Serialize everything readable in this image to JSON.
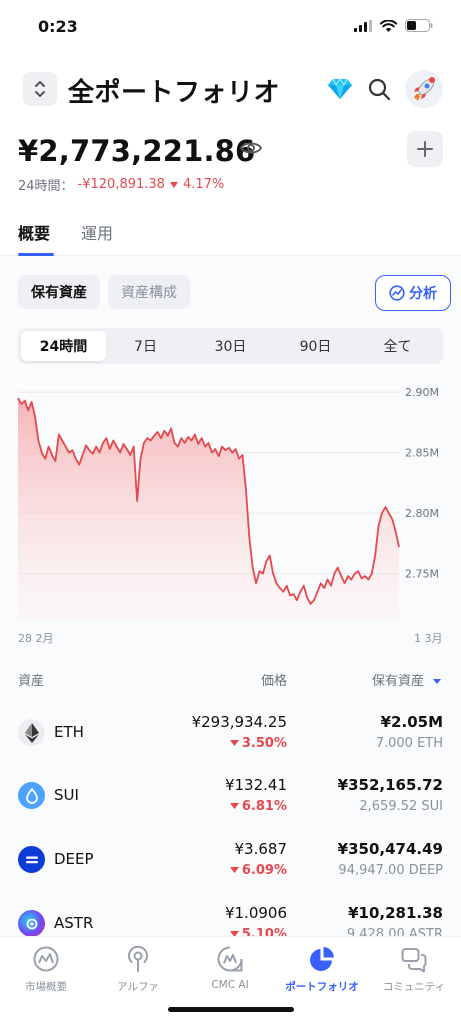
{
  "status_bar": {
    "time": "0:23"
  },
  "header": {
    "title": "全ポートフォリオ"
  },
  "portfolio": {
    "balance": "¥2,773,221.86",
    "change_label": "24時間：",
    "change_amount": "-¥120,891.38",
    "change_percent": "4.17%"
  },
  "tabs": [
    {
      "label": "概要",
      "active": true
    },
    {
      "label": "運用",
      "active": false
    }
  ],
  "view_chips": [
    {
      "label": "保有資産",
      "active": true
    },
    {
      "label": "資産構成",
      "active": false
    }
  ],
  "analyze_label": "分析",
  "ranges": [
    {
      "label": "24時間",
      "active": true
    },
    {
      "label": "7日",
      "active": false
    },
    {
      "label": "30日",
      "active": false
    },
    {
      "label": "90日",
      "active": false
    },
    {
      "label": "全て",
      "active": false
    }
  ],
  "chart_data": {
    "type": "area",
    "title": "",
    "xlabel": "",
    "ylabel": "",
    "x_start_label": "28 2月",
    "x_end_label": "1 3月",
    "y_ticks": [
      2900000,
      2850000,
      2800000,
      2750000
    ],
    "y_tick_labels": [
      "2.90M",
      "2.85M",
      "2.80M",
      "2.75M"
    ],
    "ylim": [
      2710000,
      2910000
    ],
    "grid": true,
    "color": "#e5484d",
    "series": [
      {
        "values": [
          2895000,
          2890000,
          2893000,
          2885000,
          2892000,
          2880000,
          2860000,
          2850000,
          2845000,
          2855000,
          2848000,
          2843000,
          2865000,
          2860000,
          2855000,
          2850000,
          2852000,
          2845000,
          2840000,
          2848000,
          2856000,
          2852000,
          2849000,
          2855000,
          2850000,
          2858000,
          2862000,
          2853000,
          2860000,
          2855000,
          2850000,
          2857000,
          2853000,
          2848000,
          2855000,
          2810000,
          2845000,
          2858000,
          2862000,
          2860000,
          2864000,
          2867000,
          2862000,
          2868000,
          2864000,
          2870000,
          2858000,
          2855000,
          2862000,
          2858000,
          2863000,
          2860000,
          2865000,
          2857000,
          2862000,
          2855000,
          2858000,
          2850000,
          2853000,
          2847000,
          2855000,
          2852000,
          2854000,
          2850000,
          2853000,
          2845000,
          2848000,
          2820000,
          2780000,
          2755000,
          2742000,
          2752000,
          2750000,
          2760000,
          2765000,
          2750000,
          2742000,
          2738000,
          2735000,
          2740000,
          2732000,
          2733000,
          2728000,
          2735000,
          2740000,
          2730000,
          2725000,
          2728000,
          2735000,
          2742000,
          2738000,
          2745000,
          2740000,
          2750000,
          2755000,
          2748000,
          2742000,
          2748000,
          2745000,
          2750000,
          2752000,
          2746000,
          2748000,
          2745000,
          2750000,
          2765000,
          2790000,
          2800000,
          2805000,
          2800000,
          2795000,
          2785000,
          2772000
        ]
      }
    ]
  },
  "assets_header": {
    "col_asset": "資産",
    "col_price": "価格",
    "col_holdings": "保有資産"
  },
  "assets": [
    {
      "symbol": "ETH",
      "price": "¥293,934.25",
      "change": "3.50%",
      "value": "¥2.05M",
      "amount": "7.000 ETH",
      "icon": "ethereum-icon",
      "color": "#ecedf0"
    },
    {
      "symbol": "SUI",
      "price": "¥132.41",
      "change": "6.81%",
      "value": "¥352,165.72",
      "amount": "2,659.52 SUI",
      "icon": "sui-icon",
      "color": "#4da2ff"
    },
    {
      "symbol": "DEEP",
      "price": "¥3.687",
      "change": "6.09%",
      "value": "¥350,474.49",
      "amount": "94,947.00 DEEP",
      "icon": "deep-icon",
      "color": "#0d3bd6"
    },
    {
      "symbol": "ASTR",
      "price": "¥1.0906",
      "change": "5.10%",
      "value": "¥10,281.38",
      "amount": "9,428.00 ASTR",
      "icon": "astar-icon",
      "color": "#6d4cf5"
    }
  ],
  "bottom_nav": [
    {
      "label": "市場概要",
      "icon": "market-icon",
      "active": false
    },
    {
      "label": "アルファ",
      "icon": "alpha-icon",
      "active": false
    },
    {
      "label": "CMC AI",
      "icon": "cmc-ai-icon",
      "active": false
    },
    {
      "label": "ポートフォリオ",
      "icon": "portfolio-pie-icon",
      "active": true
    },
    {
      "label": "コミュニティ",
      "icon": "community-icon",
      "active": false
    }
  ]
}
